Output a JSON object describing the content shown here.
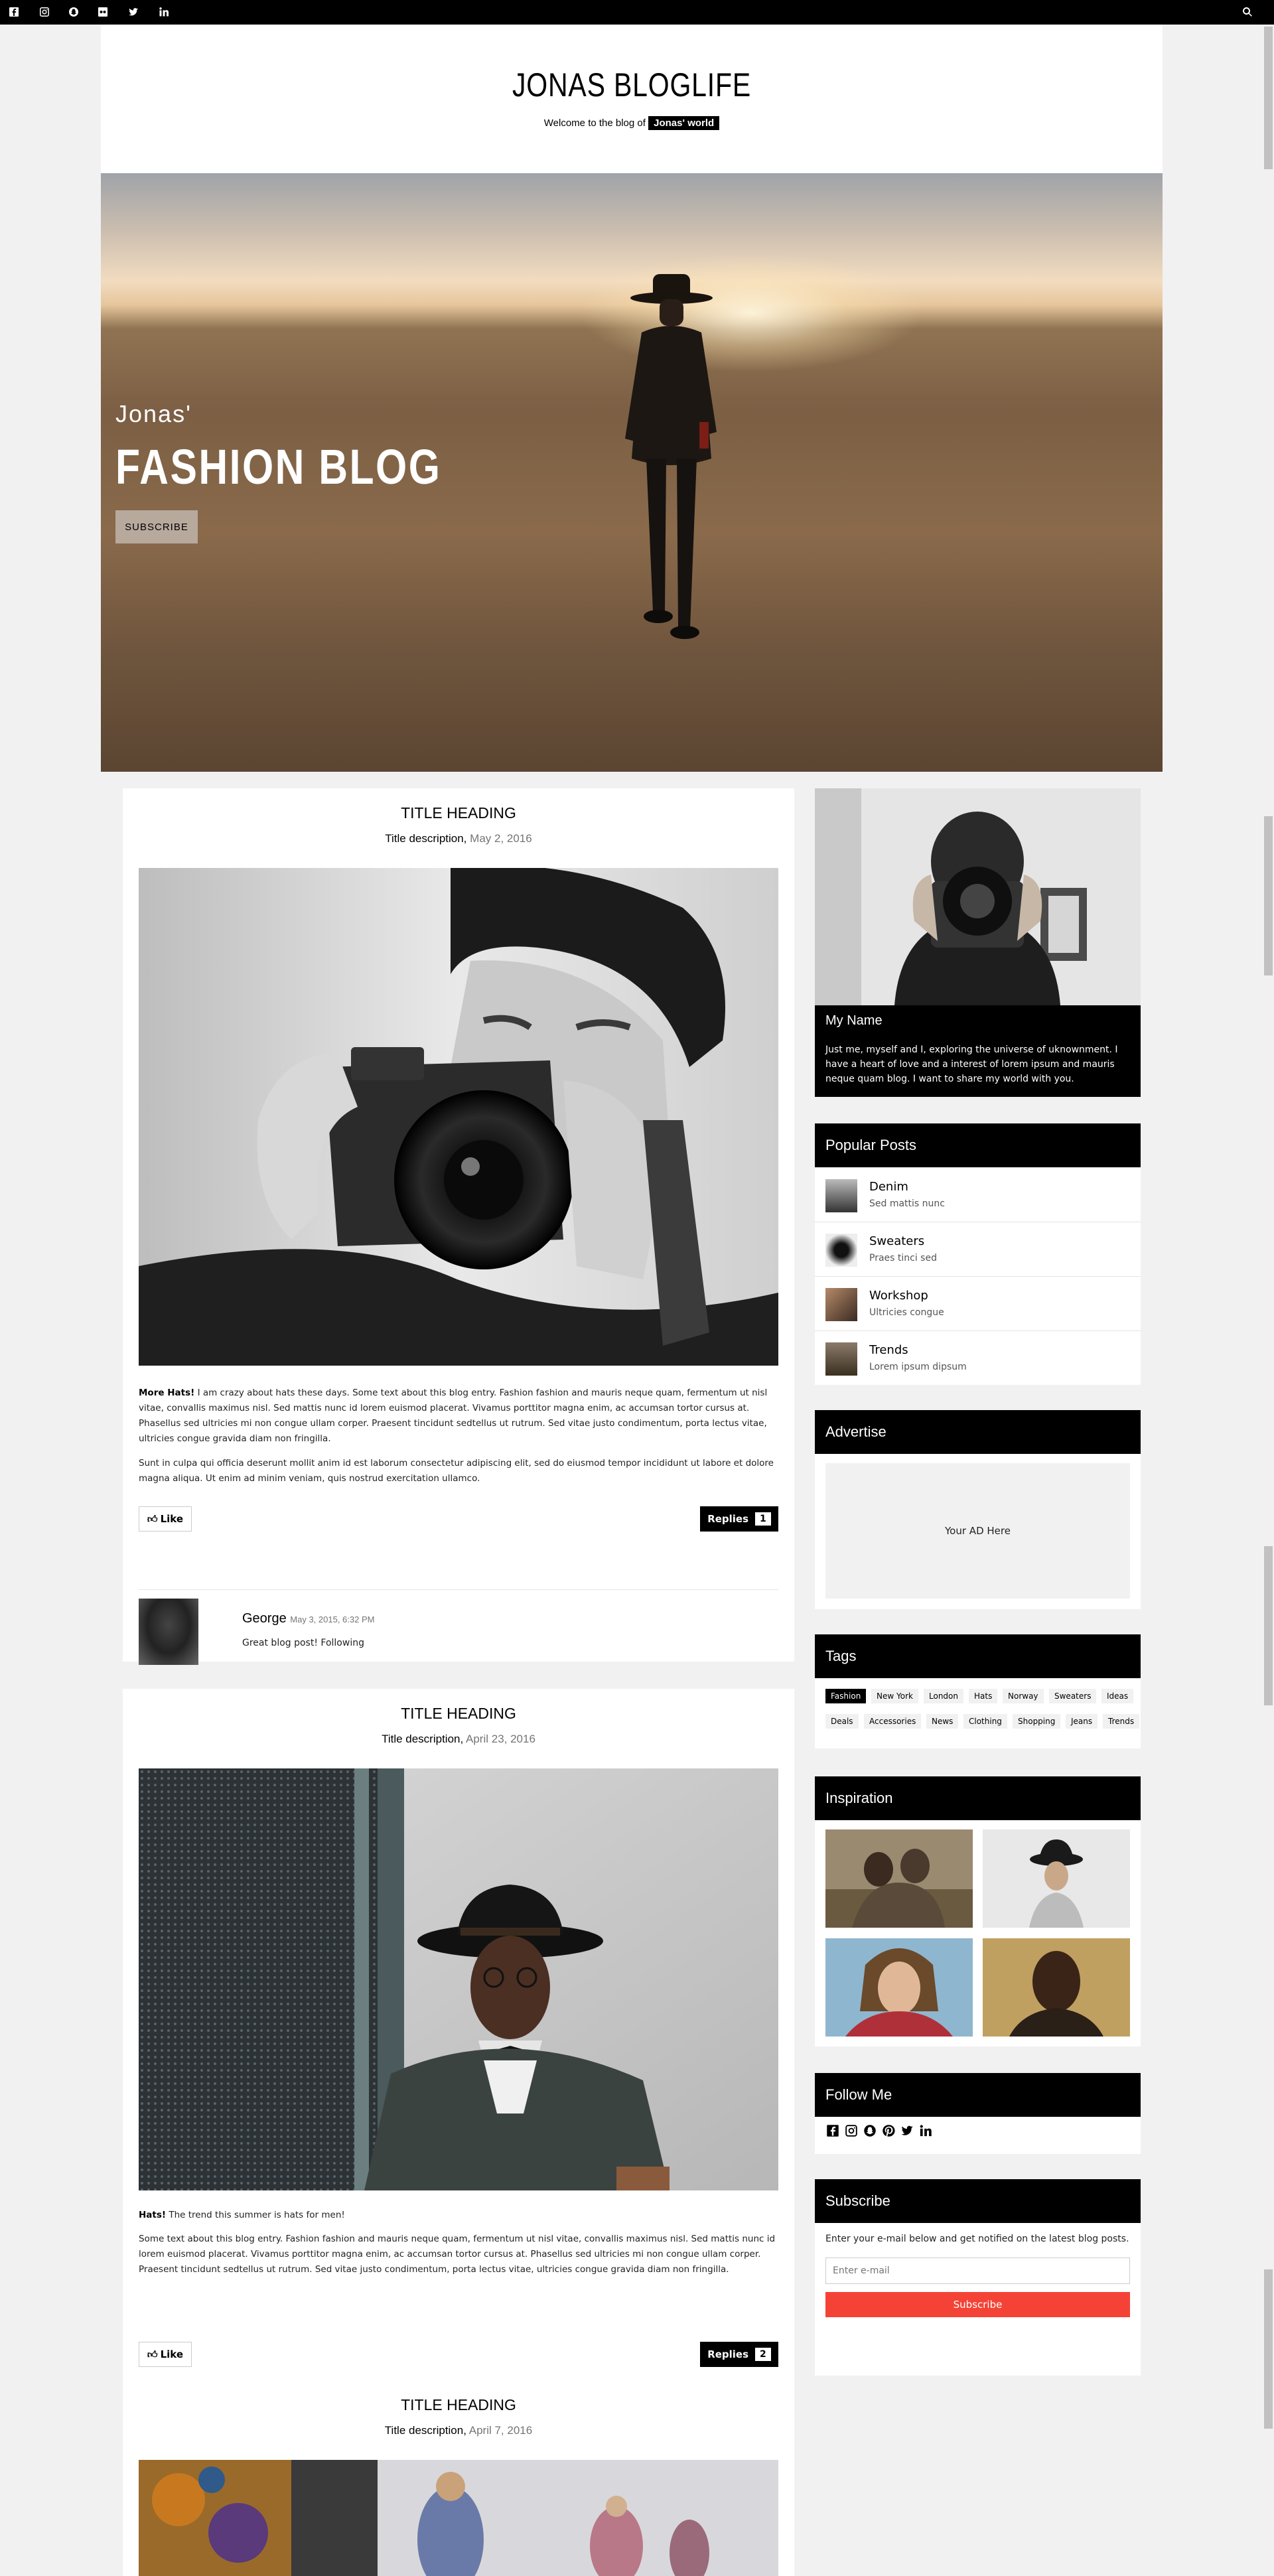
{
  "topbar": {
    "icons": [
      "facebook-icon",
      "instagram-icon",
      "snapchat-icon",
      "flickr-icon",
      "twitter-icon",
      "linkedin-icon"
    ],
    "search_icon": "search-icon"
  },
  "header": {
    "title": "JONAS BLOGLIFE",
    "tagline_prefix": "Welcome to the blog of",
    "tagline_highlight": "Jonas' world"
  },
  "hero": {
    "subtitle": "Jonas'",
    "title": "FASHION BLOG",
    "button": "SUBSCRIBE"
  },
  "posts": [
    {
      "title": "TITLE HEADING",
      "desc": "Title description,",
      "date": "May 2, 2016",
      "lead": "More Hats!",
      "p1": " I am crazy about hats these days. Some text about this blog entry. Fashion fashion and mauris neque quam, fermentum ut nisl vitae, convallis maximus nisl. Sed mattis nunc id lorem euismod placerat. Vivamus porttitor magna enim, ac accumsan tortor cursus at. Phasellus sed ultricies mi non congue ullam corper. Praesent tincidunt sedtellus ut rutrum. Sed vitae justo condimentum, porta lectus vitae, ultricies congue gravida diam non fringilla.",
      "p2": "Sunt in culpa qui officia deserunt mollit anim id est laborum consectetur adipiscing elit, sed do eiusmod tempor incididunt ut labore et dolore magna aliqua. Ut enim ad minim veniam, quis nostrud exercitation ullamco.",
      "like": "Like",
      "replies": "Replies",
      "reply_count": "1",
      "comment": {
        "name": "George",
        "date": "May 3, 2015, 6:32 PM",
        "text": "Great blog post! Following"
      }
    },
    {
      "title": "TITLE HEADING",
      "desc": "Title description,",
      "date": "April 23, 2016",
      "lead": "Hats!",
      "lead_rest": " The trend this summer is hats for men!",
      "p1": "Some text about this blog entry. Fashion fashion and mauris neque quam, fermentum ut nisl vitae, convallis maximus nisl. Sed mattis nunc id lorem euismod placerat. Vivamus porttitor magna enim, ac accumsan tortor cursus at. Phasellus sed ultricies mi non congue ullam corper. Praesent tincidunt sedtellus ut rutrum. Sed vitae justo condimentum, porta lectus vitae, ultricies congue gravida diam non fringilla.",
      "like": "Like",
      "replies": "Replies",
      "reply_count": "2"
    },
    {
      "title": "TITLE HEADING",
      "desc": "Title description,",
      "date": "April 7, 2016"
    }
  ],
  "sidebar": {
    "about": {
      "name": "My Name",
      "text": "Just me, myself and I, exploring the universe of uknownment. I have a heart of love and a interest of lorem ipsum and mauris neque quam blog. I want to share my world with you."
    },
    "popular": {
      "heading": "Popular Posts",
      "items": [
        {
          "title": "Denim",
          "sub": "Sed mattis nunc"
        },
        {
          "title": "Sweaters",
          "sub": "Praes tinci sed"
        },
        {
          "title": "Workshop",
          "sub": "Ultricies congue"
        },
        {
          "title": "Trends",
          "sub": "Lorem ipsum dipsum"
        }
      ]
    },
    "advertise": {
      "heading": "Advertise",
      "ad": "Your AD Here"
    },
    "tags": {
      "heading": "Tags",
      "row1": [
        "Fashion",
        "New York",
        "London",
        "Hats",
        "Norway",
        "Sweaters",
        "Ideas"
      ],
      "row2": [
        "Deals",
        "Accessories",
        "News",
        "Clothing",
        "Shopping",
        "Jeans",
        "Trends"
      ],
      "active": "Fashion"
    },
    "inspiration": {
      "heading": "Inspiration"
    },
    "follow": {
      "heading": "Follow Me",
      "icons": [
        "facebook-icon",
        "instagram-icon",
        "snapchat-icon",
        "pinterest-icon",
        "twitter-icon",
        "linkedin-icon"
      ]
    },
    "subscribe": {
      "heading": "Subscribe",
      "text": "Enter your e-mail below and get notified on the latest blog posts.",
      "placeholder": "Enter e-mail",
      "button": "Subscribe"
    }
  },
  "colors": {
    "accent": "#f44336",
    "dark": "#000000",
    "page_bg": "#f1f1f1"
  }
}
